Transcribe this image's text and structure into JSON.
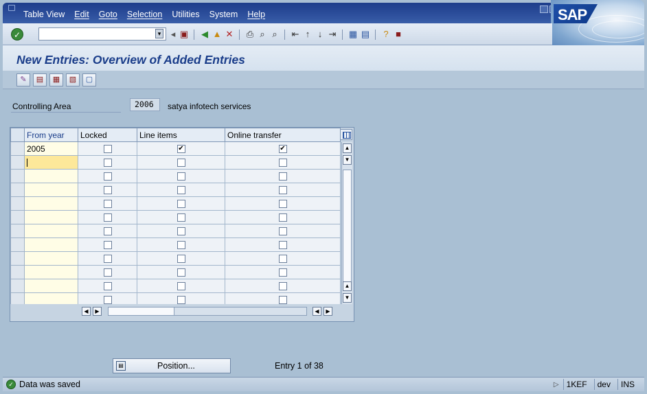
{
  "menubar": {
    "items": [
      "Table View",
      "Edit",
      "Goto",
      "Selection",
      "Utilities",
      "System",
      "Help"
    ],
    "brand": "SAP"
  },
  "toolbar": {
    "command_field_value": "",
    "icons": [
      "enter-icon",
      "back-icon",
      "save-icon",
      "back-arrow-icon",
      "exit-icon",
      "cancel-icon",
      "print-icon",
      "find-icon",
      "find-next-icon",
      "first-page-icon",
      "previous-page-icon",
      "next-page-icon",
      "last-page-icon",
      "create-session-icon",
      "shortcut-icon",
      "help-icon",
      "layout-icon"
    ]
  },
  "page": {
    "title": "New Entries: Overview of Added Entries"
  },
  "app_toolbar": {
    "icons": [
      "change-display-icon",
      "save-icon",
      "select-all-icon",
      "select-block-icon",
      "deselect-all-icon"
    ]
  },
  "controlling_area": {
    "label": "Controlling Area",
    "value": "2006",
    "description": "satya infotech  services"
  },
  "table": {
    "columns": [
      "From year",
      "Locked",
      "Line items",
      "Online transfer"
    ],
    "rows": [
      {
        "from_year": "2005",
        "locked": false,
        "line_items": true,
        "online_transfer": true
      },
      {
        "from_year": "",
        "locked": false,
        "line_items": false,
        "online_transfer": false
      },
      {
        "from_year": "",
        "locked": false,
        "line_items": false,
        "online_transfer": false
      },
      {
        "from_year": "",
        "locked": false,
        "line_items": false,
        "online_transfer": false
      },
      {
        "from_year": "",
        "locked": false,
        "line_items": false,
        "online_transfer": false
      },
      {
        "from_year": "",
        "locked": false,
        "line_items": false,
        "online_transfer": false
      },
      {
        "from_year": "",
        "locked": false,
        "line_items": false,
        "online_transfer": false
      },
      {
        "from_year": "",
        "locked": false,
        "line_items": false,
        "online_transfer": false
      },
      {
        "from_year": "",
        "locked": false,
        "line_items": false,
        "online_transfer": false
      },
      {
        "from_year": "",
        "locked": false,
        "line_items": false,
        "online_transfer": false
      },
      {
        "from_year": "",
        "locked": false,
        "line_items": false,
        "online_transfer": false
      },
      {
        "from_year": "",
        "locked": false,
        "line_items": false,
        "online_transfer": false
      }
    ]
  },
  "footer": {
    "position_button": "Position...",
    "entry_info": "Entry 1 of 38"
  },
  "status": {
    "message": "Data was saved",
    "transaction": "1KEF",
    "server": "dev",
    "mode": "INS"
  },
  "colors": {
    "title_text": "#1a3d8a",
    "background": "#a9bfd3",
    "menubar": "#2d4f9c",
    "active_cell": "#fde89a"
  }
}
